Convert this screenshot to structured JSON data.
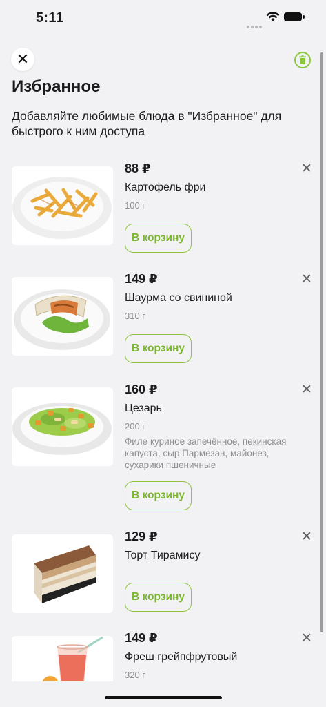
{
  "status": {
    "time": "5:11"
  },
  "header": {
    "title": "Избранное",
    "subtitle": "Добавляйте любимые блюда в \"Избранное\" для быстрого к ним доступа"
  },
  "colors": {
    "accent": "#8cc63f",
    "background": "#f2f2f4"
  },
  "icons": {
    "close": "close-icon",
    "trash": "trash-icon",
    "remove": "remove-x-icon"
  },
  "items": [
    {
      "price": "88 ₽",
      "name": "Картофель фри",
      "weight": "100 г",
      "description": "",
      "cart_label": "В корзину",
      "image": "french-fries-plate"
    },
    {
      "price": "149 ₽",
      "name": "Шаурма со свининой",
      "weight": "310 г",
      "description": "",
      "cart_label": "В корзину",
      "image": "shawarma-plate"
    },
    {
      "price": "160 ₽",
      "name": "Цезарь",
      "weight": "200 г",
      "description": "Филе куриное запечённое, пекинская капуста, сыр Пармезан, майонез, сухарики пшеничные",
      "cart_label": "В корзину",
      "image": "caesar-salad-plate"
    },
    {
      "price": "129 ₽",
      "name": "Торт Тирамису",
      "weight": "",
      "description": "",
      "cart_label": "В корзину",
      "image": "tiramisu-cake"
    },
    {
      "price": "149 ₽",
      "name": "Фреш грейпфрутовый",
      "weight": "320 г",
      "description": "",
      "cart_label": "",
      "image": "grapefruit-juice-glass"
    }
  ]
}
